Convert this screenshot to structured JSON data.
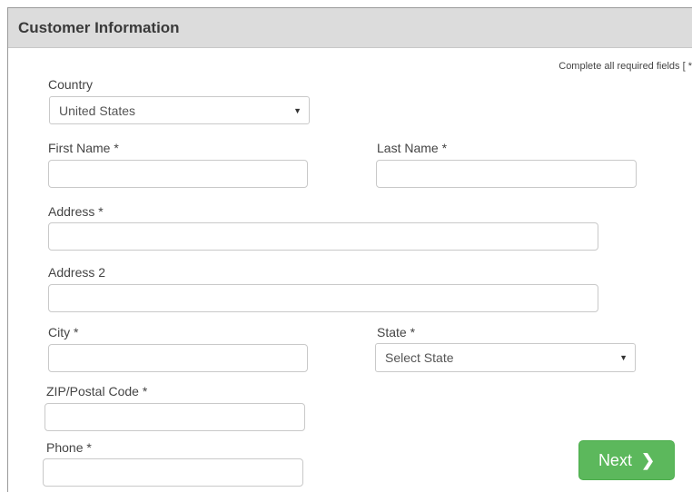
{
  "header": {
    "title": "Customer Information"
  },
  "required_note": "Complete all required fields [ *",
  "form": {
    "country": {
      "label": "Country",
      "value": "United States"
    },
    "first_name": {
      "label": "First Name *",
      "value": ""
    },
    "last_name": {
      "label": "Last Name *",
      "value": ""
    },
    "address": {
      "label": "Address *",
      "value": ""
    },
    "address2": {
      "label": "Address 2",
      "value": ""
    },
    "city": {
      "label": "City *",
      "value": ""
    },
    "state": {
      "label": "State *",
      "value": "Select State"
    },
    "zip": {
      "label": "ZIP/Postal Code *",
      "value": ""
    },
    "phone": {
      "label": "Phone *",
      "value": ""
    }
  },
  "next_button": {
    "label": "Next",
    "icon": "chevron-right-icon"
  },
  "colors": {
    "header_bg": "#dcdcdc",
    "next_button_bg": "#5cb85c"
  }
}
